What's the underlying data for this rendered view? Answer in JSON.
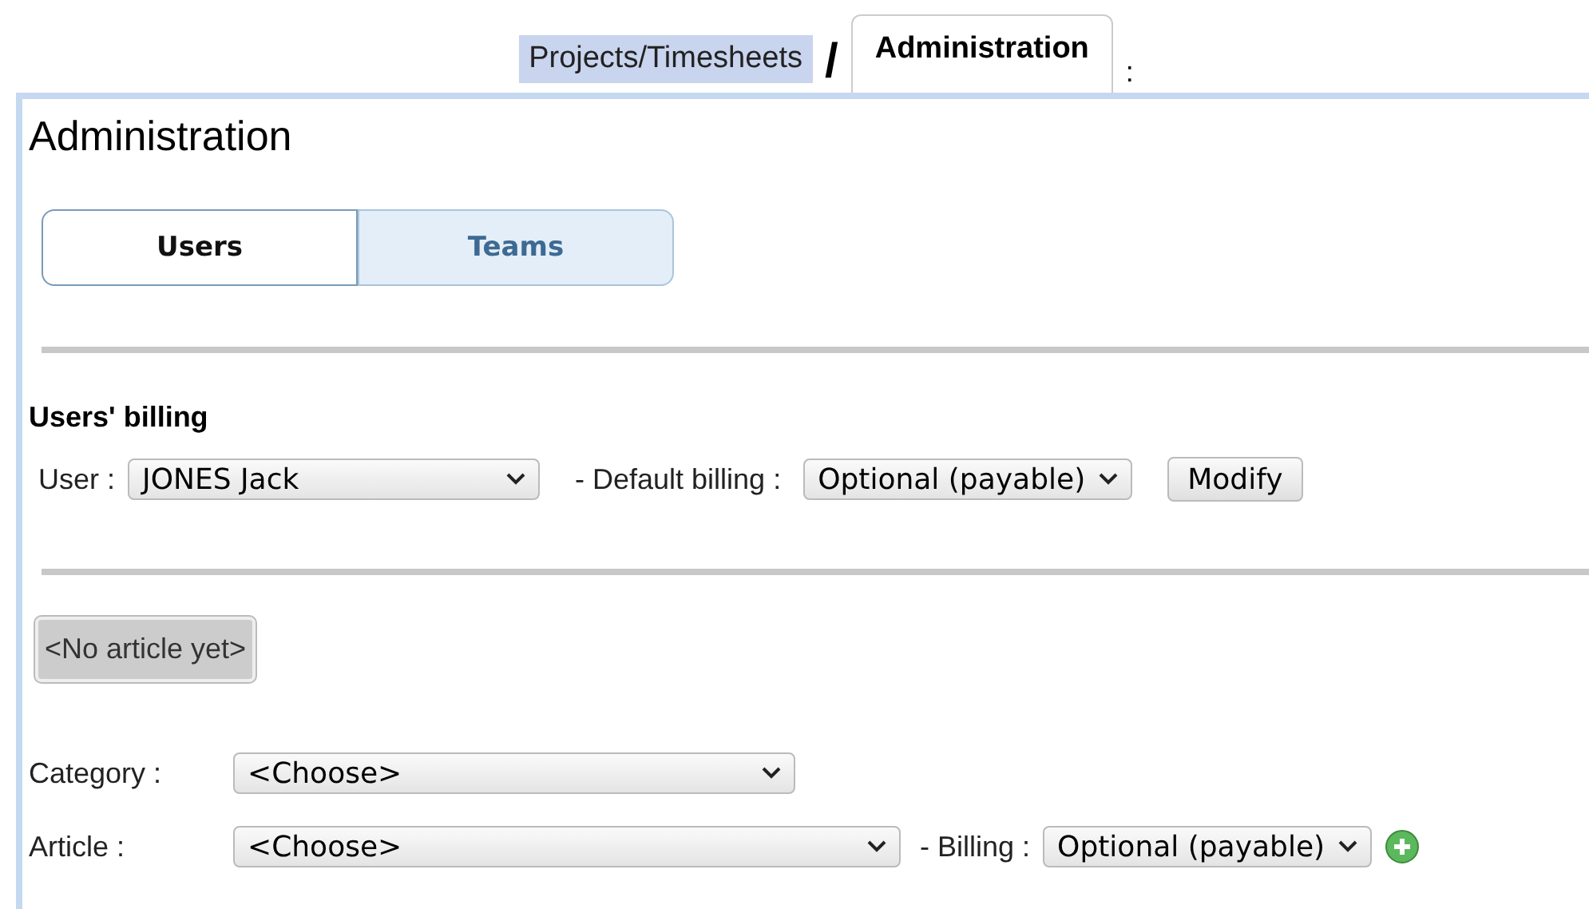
{
  "breadcrumb": {
    "link": "Projects/Timesheets",
    "separator": "/",
    "current_tab": "Administration",
    "suffix": ":"
  },
  "heading": "Administration",
  "tabs": [
    {
      "label": "Users",
      "selected": true
    },
    {
      "label": "Teams",
      "selected": false
    }
  ],
  "users_billing": {
    "title": "Users' billing",
    "user_label": "User :",
    "user_value": "JONES Jack",
    "default_billing_label": "- Default billing :",
    "default_billing_value": "Optional (payable)",
    "modify_button": "Modify"
  },
  "articles": {
    "empty_label": "<No article yet>",
    "category_label": "Category :",
    "category_value": "<Choose>",
    "article_label": "Article :",
    "article_value": "<Choose>",
    "billing_label": "- Billing :",
    "billing_value": "Optional (payable)"
  }
}
